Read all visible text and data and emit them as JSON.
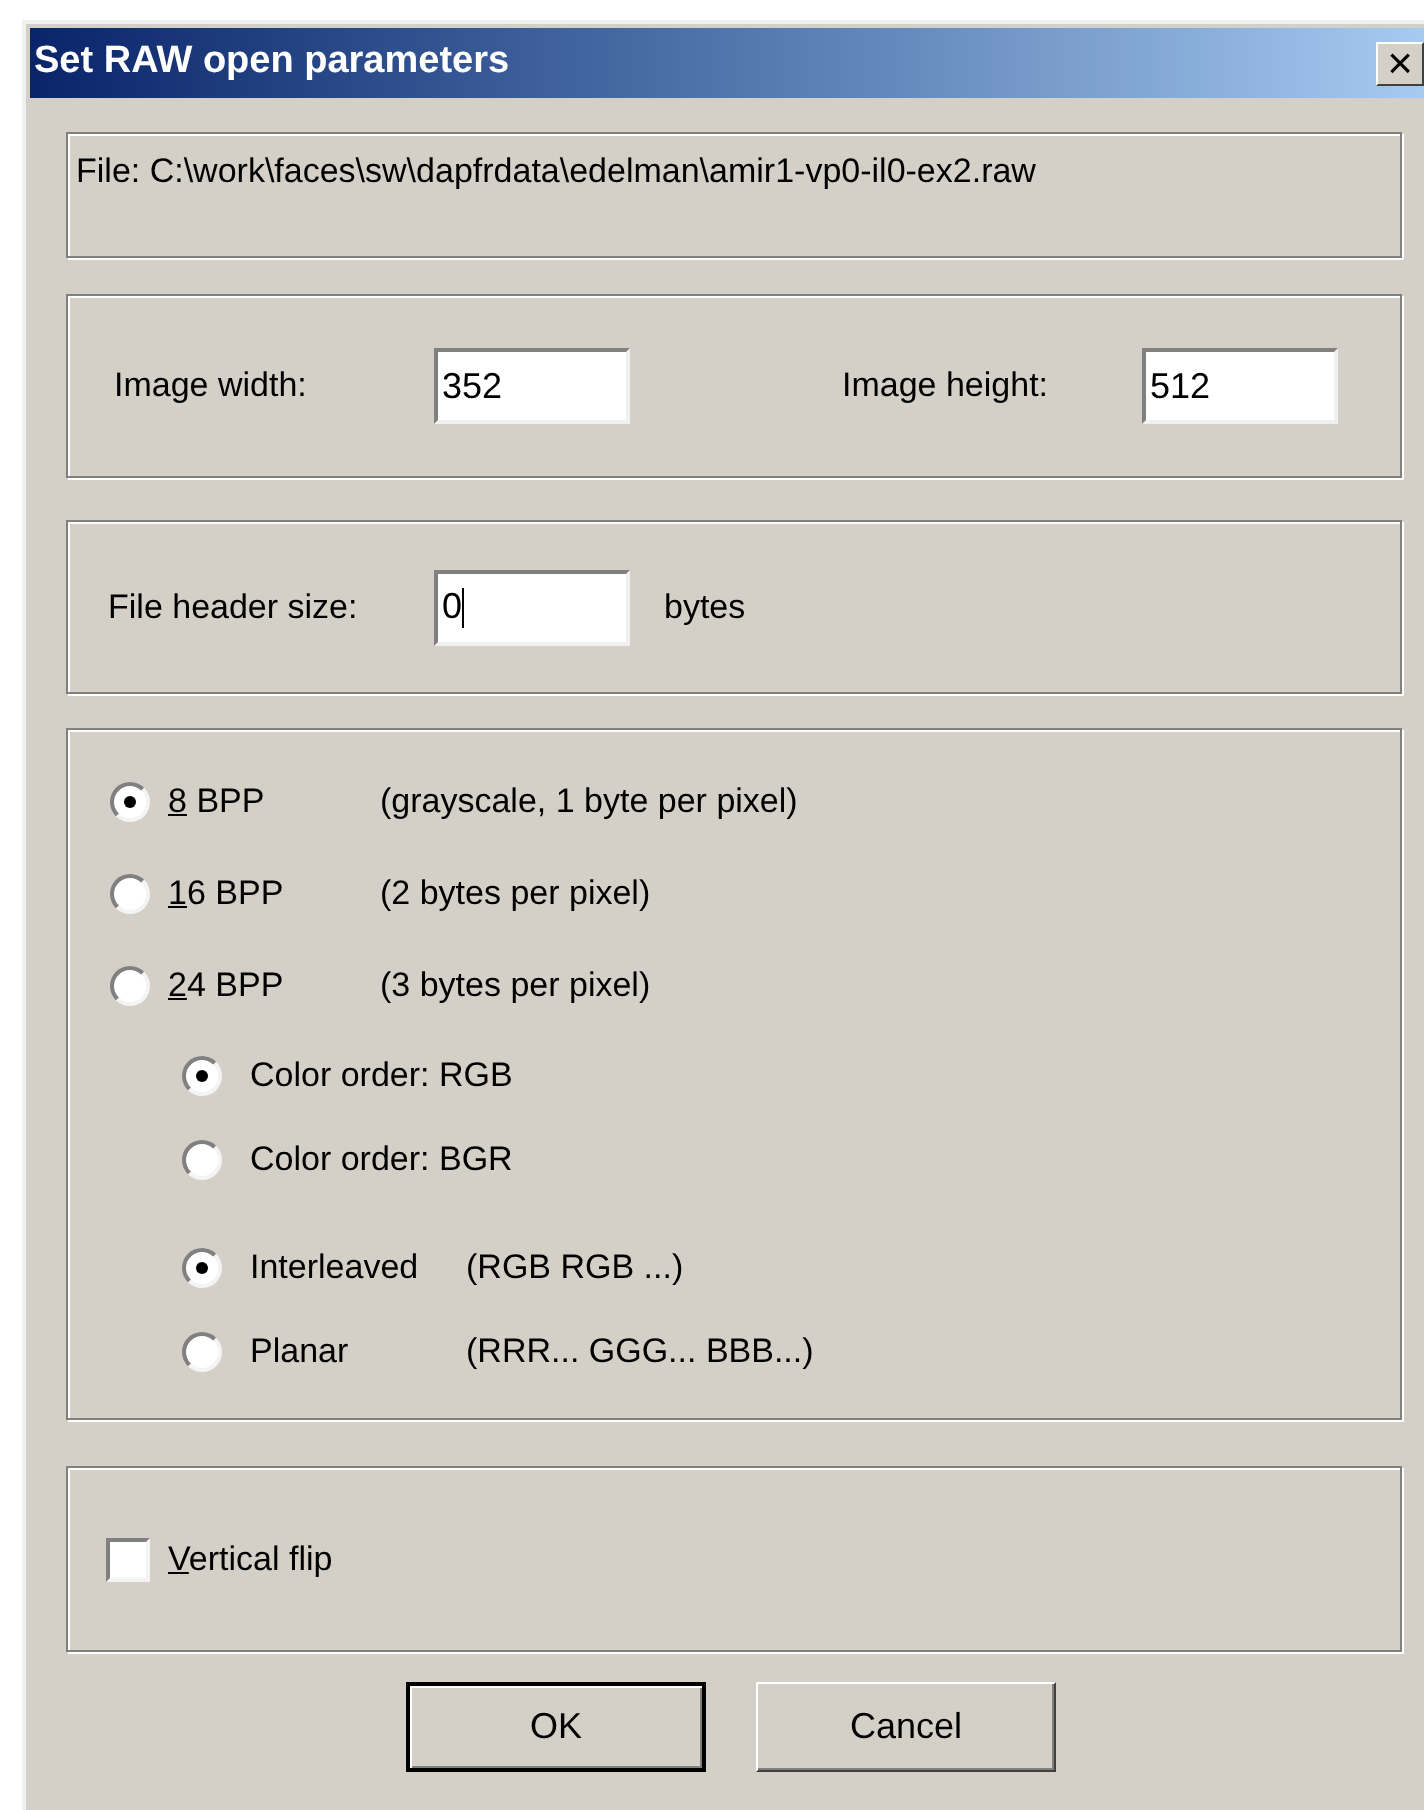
{
  "window": {
    "title": "Set RAW open parameters",
    "close": "×"
  },
  "file_label": "File: C:\\work\\faces\\sw\\dapfrdata\\edelman\\amir1-vp0-il0-ex2.raw",
  "image_width": {
    "label": "Image width:",
    "value": "352"
  },
  "image_height": {
    "label": "Image height:",
    "value": "512"
  },
  "header_size": {
    "label": "File header size:",
    "value": "0",
    "unit": "bytes",
    "focused": true
  },
  "bpp_options": [
    {
      "key": "8",
      "rest": " BPP",
      "note": "(grayscale, 1 byte per pixel)",
      "selected": true
    },
    {
      "key": "1",
      "rest": "6 BPP",
      "note": "(2 bytes per pixel)",
      "selected": false
    },
    {
      "key": "2",
      "rest": "4 BPP",
      "note": "(3 bytes per pixel)",
      "selected": false
    }
  ],
  "color_order": [
    {
      "label": "Color order: RGB",
      "selected": true
    },
    {
      "label": "Color order: BGR",
      "selected": false
    }
  ],
  "layout": [
    {
      "label": "Interleaved",
      "note": "(RGB RGB ...)",
      "selected": true
    },
    {
      "label": "Planar",
      "note": "(RRR... GGG... BBB...)",
      "selected": false
    }
  ],
  "vertical_flip": {
    "key": "V",
    "rest": "ertical flip",
    "checked": false
  },
  "buttons": [
    {
      "label": "OK",
      "default": true
    },
    {
      "label": "Cancel",
      "default": false
    }
  ]
}
